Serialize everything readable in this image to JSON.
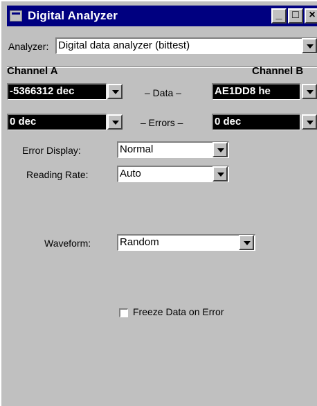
{
  "window": {
    "title": "Digital Analyzer",
    "minimize_glyph": "_",
    "maximize_glyph": "□",
    "close_glyph": "×"
  },
  "analyzer": {
    "label": "Analyzer:",
    "value": "Digital data analyzer (bittest)"
  },
  "channels": {
    "a_label": "Channel A",
    "b_label": "Channel B"
  },
  "data_row": {
    "label": "– Data –",
    "a_value": "-5366312 dec",
    "b_value": "AE1DD8  he"
  },
  "errors_row": {
    "label": "– Errors –",
    "a_value": "0      dec",
    "b_value": "0      dec"
  },
  "error_display": {
    "label": "Error Display:",
    "value": "Normal"
  },
  "reading_rate": {
    "label": "Reading Rate:",
    "value": "Auto"
  },
  "waveform": {
    "label": "Waveform:",
    "value": "Random"
  },
  "freeze": {
    "label": "Freeze Data on Error",
    "checked": false
  },
  "colors": {
    "titlebar": "#000080",
    "face": "#c0c0c0",
    "display_bg": "#000000",
    "display_fg": "#ffffff"
  }
}
